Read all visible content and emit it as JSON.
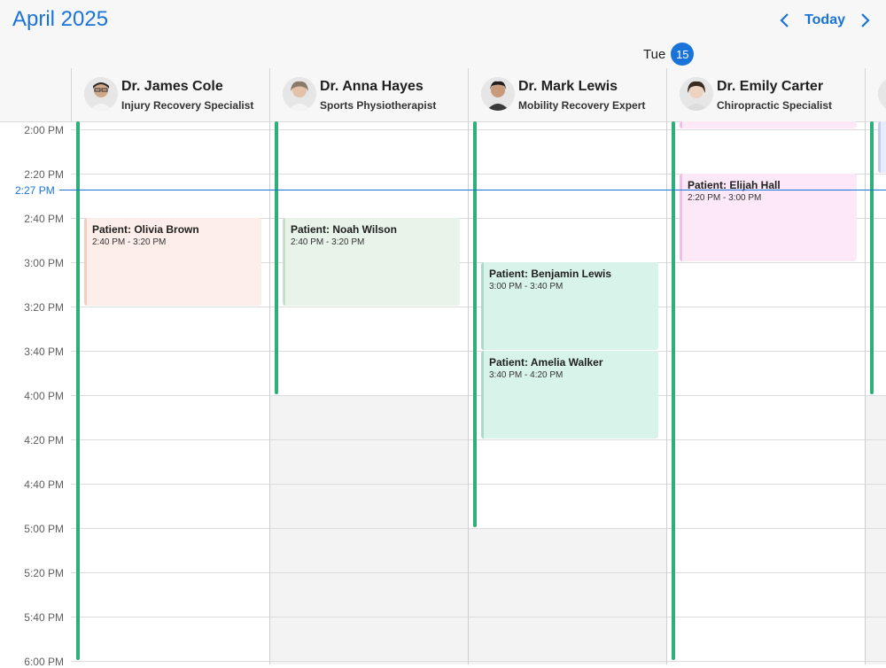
{
  "header": {
    "month_title": "April 2025",
    "today_label": "Today",
    "day_name": "Tue",
    "day_number": "15"
  },
  "resources": [
    {
      "name": "Dr. James Cole",
      "specialty": "Injury Recovery Specialist"
    },
    {
      "name": "Dr. Anna Hayes",
      "specialty": "Sports Physiotherapist"
    },
    {
      "name": "Dr. Mark Lewis",
      "specialty": "Mobility Recovery Expert"
    },
    {
      "name": "Dr. Emily Carter",
      "specialty": "Chiropractic Specialist"
    }
  ],
  "time_slots": [
    "2:00 PM",
    "2:20 PM",
    "2:40 PM",
    "3:00 PM",
    "3:20 PM",
    "3:40 PM",
    "4:00 PM",
    "4:20 PM",
    "4:40 PM",
    "5:00 PM",
    "5:20 PM",
    "5:40 PM",
    "6:00 PM"
  ],
  "current_time": "2:27 PM",
  "events": [
    {
      "title": "Patient: Olivia Brown",
      "time": "2:40 PM - 3:20 PM"
    },
    {
      "title": "Patient: Noah Wilson",
      "time": "2:40 PM - 3:20 PM"
    },
    {
      "title": "Patient: Benjamin Lewis",
      "time": "3:00 PM - 3:40 PM"
    },
    {
      "title": "Patient: Amelia Walker",
      "time": "3:40 PM - 4:20 PM"
    },
    {
      "title": "Patient: Elijah Hall",
      "time": "2:20 PM - 3:00 PM"
    }
  ],
  "colors": {
    "accent": "#1a73d9",
    "availability_bar": "#2eaf78",
    "event_olivia": "#fdeee9",
    "event_noah": "#e8f3ea",
    "event_benjamin": "#d8f4ea",
    "event_elijah": "#fce8f6",
    "unavailable": "#f3f3f3"
  }
}
